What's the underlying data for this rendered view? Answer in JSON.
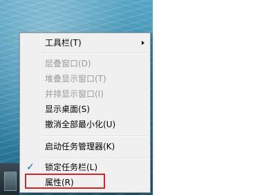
{
  "menu": {
    "items": [
      {
        "label": "工具栏(T)",
        "enabled": true,
        "submenu": true
      },
      {
        "label": "层叠窗口(D)",
        "enabled": false
      },
      {
        "label": "堆叠显示窗口(T)",
        "enabled": false
      },
      {
        "label": "并排显示窗口(I)",
        "enabled": false
      },
      {
        "label": "显示桌面(S)",
        "enabled": true
      },
      {
        "label": "撤消全部最小化(U)",
        "enabled": true
      },
      {
        "label": "启动任务管理器(K)",
        "enabled": true
      },
      {
        "label": "锁定任务栏(L)",
        "enabled": true,
        "checked": true
      },
      {
        "label": "属性(R)",
        "enabled": true,
        "highlighted": true
      }
    ],
    "check_glyph": "✓",
    "highlight_color": "#d1242b"
  }
}
